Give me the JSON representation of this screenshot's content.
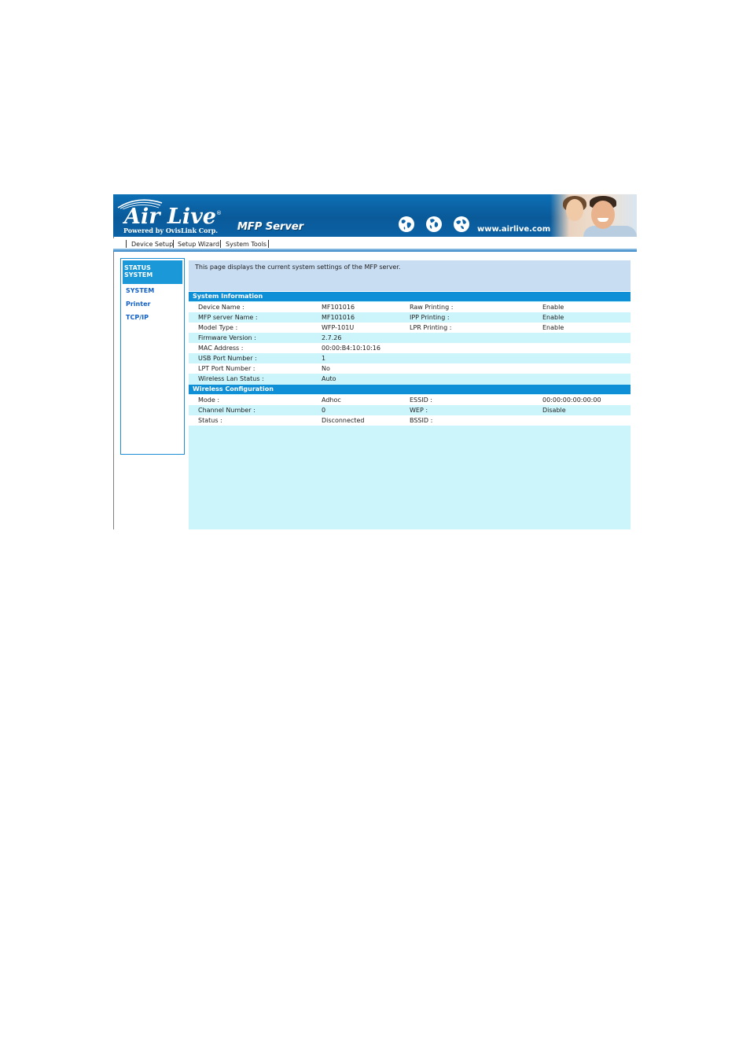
{
  "header": {
    "brand": "Air Live",
    "brand_mark": "®",
    "brand_sub": "Powered by OvisLink Corp.",
    "product": "MFP Server",
    "url": "www.airlive.com",
    "icons": [
      "swoosh-icon",
      "globe-icon",
      "globe-icon",
      "globe-icon"
    ]
  },
  "menu": [
    "Device Setup",
    "Setup Wizard",
    "System Tools"
  ],
  "sidebar": {
    "heading_line1": "STATUS",
    "heading_line2": "SYSTEM",
    "items": [
      "SYSTEM",
      "Printer",
      "TCP/IP"
    ]
  },
  "intro": "This page displays the current system settings of the MFP server.",
  "system_information": {
    "title": "System Information",
    "rows": [
      [
        "Device Name :",
        "MF101016",
        "Raw Printing :",
        "Enable"
      ],
      [
        "MFP server Name :",
        "MF101016",
        "IPP Printing :",
        "Enable"
      ],
      [
        "Model Type :",
        "WFP-101U",
        "LPR Printing :",
        "Enable"
      ],
      [
        "Firmware Version :",
        "2.7.26",
        "",
        ""
      ],
      [
        "MAC Address :",
        "00:00:B4:10:10:16",
        "",
        ""
      ],
      [
        "USB Port Number :",
        "1",
        "",
        ""
      ],
      [
        "LPT Port Number :",
        "No",
        "",
        ""
      ],
      [
        "Wireless Lan Status :",
        "Auto",
        "",
        ""
      ]
    ]
  },
  "wireless_configuration": {
    "title": "Wireless Configuration",
    "rows": [
      [
        "Mode :",
        "Adhoc",
        "ESSID :",
        "00:00:00:00:00:00"
      ],
      [
        "Channel Number :",
        "0",
        "WEP :",
        "Disable"
      ],
      [
        "Status :",
        "Disconnected",
        "BSSID :",
        ""
      ]
    ]
  },
  "colors": {
    "banner": "#0b62a6",
    "section_header": "#0e8fd6",
    "content_bg": "#ccf5fb",
    "intro_bg": "#c8dcf2",
    "link": "#1060c8"
  }
}
